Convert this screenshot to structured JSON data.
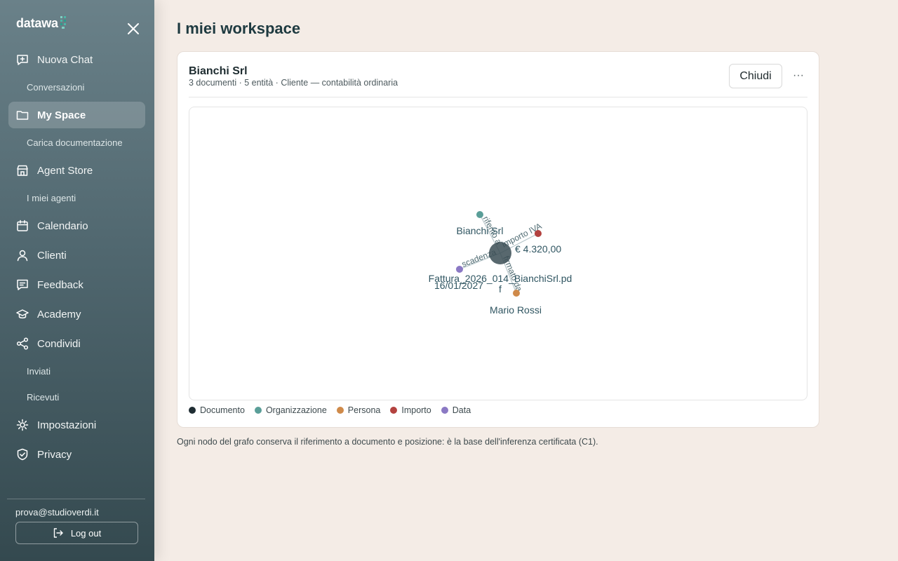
{
  "sidebar": {
    "brand": "datawa",
    "nav": [
      {
        "label": "Nuova Chat",
        "icon": "chat-plus-icon"
      },
      {
        "label": "My Space",
        "icon": "folder-icon",
        "active": true
      },
      {
        "label": "Agent Store",
        "icon": "store-icon"
      },
      {
        "label": "Calendario",
        "icon": "calendar-icon"
      },
      {
        "label": "Clienti",
        "icon": "user-icon"
      },
      {
        "label": "Feedback",
        "icon": "feedback-icon"
      },
      {
        "label": "Academy",
        "icon": "graduation-cap-icon"
      },
      {
        "label": "Condividi",
        "icon": "share-icon"
      },
      {
        "label": "Impostazioni",
        "icon": "gear-icon"
      },
      {
        "label": "Privacy",
        "icon": "shield-check-icon"
      }
    ],
    "sub": {
      "conversazioni": "Conversazioni",
      "carica": "Carica documentazione",
      "agenti": "I miei agenti",
      "inviati": "Inviati",
      "ricevuti": "Ricevuti"
    },
    "user_email": "prova@studioverdi.it",
    "logout_label": "Log out"
  },
  "main": {
    "title": "I miei workspace",
    "workspace": {
      "name": "Bianchi Srl",
      "meta": "3 documenti · 5 entità · Cliente — contabilità ordinaria",
      "close_label": "Chiudi",
      "more_label": "···"
    },
    "footnote": "Ogni nodo del grafo conserva il riferimento a documento e posizione: è la base dell'inferenza certificata (C1)."
  },
  "graph": {
    "center_label_line1": "Fattura_2026_014_BianchiSrl.pd",
    "center_label_line2": "f",
    "nodes": [
      {
        "label": "Bianchi Srl",
        "edge": "riferito a",
        "type": "Organizzazione"
      },
      {
        "label": "€ 4.320,00",
        "edge": "importo IVA",
        "type": "Importo"
      },
      {
        "label": "16/01/2027",
        "edge": "scadenza",
        "type": "Data"
      },
      {
        "label": "Mario Rossi",
        "edge": "firmato da",
        "type": "Persona"
      }
    ],
    "legend": [
      {
        "label": "Documento",
        "color": "#1f2d33"
      },
      {
        "label": "Organizzazione",
        "color": "#5a9e98"
      },
      {
        "label": "Persona",
        "color": "#cf8a4a"
      },
      {
        "label": "Importo",
        "color": "#b3423f"
      },
      {
        "label": "Data",
        "color": "#8b79c4"
      }
    ]
  }
}
